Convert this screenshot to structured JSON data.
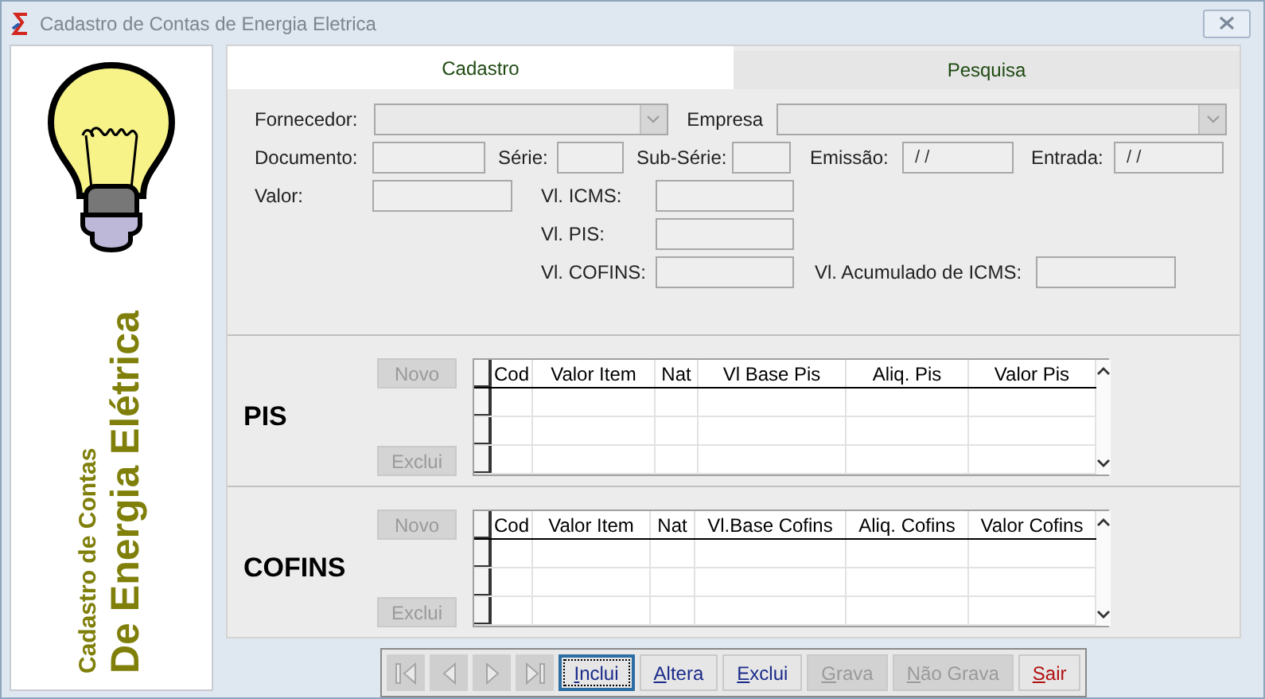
{
  "window": {
    "title": "Cadastro de Contas de Energia Eletrica"
  },
  "sidebar": {
    "subtitle": "Cadastro de Contas",
    "title": "De Energia Elétrica"
  },
  "tabs": [
    {
      "label": "Cadastro",
      "selected": true
    },
    {
      "label": "Pesquisa",
      "selected": false
    }
  ],
  "form": {
    "rows": [
      [
        {
          "label": "Fornecedor:",
          "kind": "combo"
        },
        {
          "label": "Empresa",
          "kind": "combo"
        }
      ],
      [
        {
          "label": "Documento:",
          "kind": "text"
        },
        {
          "label": "Série:",
          "kind": "text"
        },
        {
          "label": "Sub-Série:",
          "kind": "text"
        },
        {
          "label": "Emissão:",
          "kind": "text",
          "value": "/ /"
        },
        {
          "label": "Entrada:",
          "kind": "text",
          "value": "/ /"
        }
      ],
      [
        {
          "label": "Valor:",
          "kind": "text"
        },
        {
          "label": "Vl. ICMS:",
          "kind": "text"
        }
      ],
      [
        {
          "kind": "empty"
        },
        {
          "label": "Vl. PIS:",
          "kind": "text"
        }
      ],
      [
        {
          "kind": "empty"
        },
        {
          "label": "Vl. COFINS:",
          "kind": "text"
        },
        {
          "kind": "empty"
        },
        {
          "label": "Vl. Acumulado de ICMS:",
          "kind": "text"
        }
      ]
    ]
  },
  "sections": [
    {
      "title": "PIS",
      "buttons": [
        {
          "label": "Novo",
          "disabled": true
        },
        {
          "label": "Exclui",
          "disabled": true
        }
      ],
      "columns": [
        "Cod",
        "Valor Item",
        "Nat",
        "Vl Base Pis",
        "Aliq. Pis",
        "Valor Pis"
      ]
    },
    {
      "title": "COFINS",
      "buttons": [
        {
          "label": "Novo",
          "disabled": true
        },
        {
          "label": "Exclui",
          "disabled": true
        }
      ],
      "columns": [
        "Cod",
        "Valor Item",
        "Nat",
        "Vl.Base Cofins",
        "Aliq. Cofins",
        "Valor Cofins"
      ]
    }
  ],
  "navigator": [
    {
      "kind": "first",
      "disabled": true
    },
    {
      "kind": "prev",
      "disabled": true
    },
    {
      "kind": "next",
      "disabled": true
    },
    {
      "kind": "last",
      "disabled": true
    }
  ],
  "actions": [
    {
      "label": "Inclui",
      "disabled": false,
      "focused": true,
      "kind": "normal"
    },
    {
      "label": "Altera",
      "disabled": false,
      "focused": false,
      "kind": "normal"
    },
    {
      "label": "Exclui",
      "disabled": false,
      "focused": false,
      "kind": "normal"
    },
    {
      "label": "Grava",
      "disabled": true,
      "focused": false,
      "kind": "normal"
    },
    {
      "label": "Não Grava",
      "disabled": true,
      "focused": false,
      "kind": "normal"
    },
    {
      "label": "Sair",
      "disabled": false,
      "focused": false,
      "kind": "exit"
    }
  ]
}
